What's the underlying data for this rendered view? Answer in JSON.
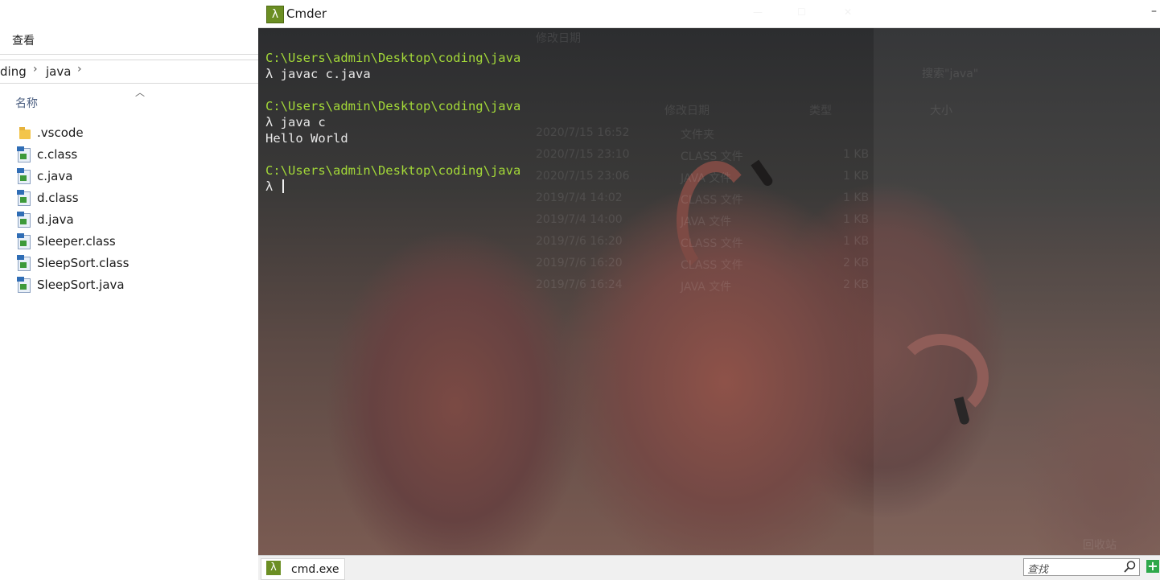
{
  "explorer": {
    "menu_tab": "查看",
    "breadcrumb": [
      "ding",
      "java"
    ],
    "column_header": "名称",
    "files": [
      {
        "name": ".vscode",
        "icon": "folder-icon"
      },
      {
        "name": "c.class",
        "icon": "java-file-icon"
      },
      {
        "name": "c.java",
        "icon": "java-file-icon"
      },
      {
        "name": "d.class",
        "icon": "java-file-icon"
      },
      {
        "name": "d.java",
        "icon": "java-file-icon"
      },
      {
        "name": "Sleeper.class",
        "icon": "java-file-icon"
      },
      {
        "name": "SleepSort.class",
        "icon": "java-file-icon"
      },
      {
        "name": "SleepSort.java",
        "icon": "java-file-icon"
      }
    ]
  },
  "cmder": {
    "title": "Cmder",
    "terminal": [
      {
        "path": "C:\\Users\\admin\\Desktop\\coding\\java",
        "command": "λ javac c.java",
        "output": ""
      },
      {
        "path": "C:\\Users\\admin\\Desktop\\coding\\java",
        "command": "λ java c",
        "output": "Hello World"
      },
      {
        "path": "C:\\Users\\admin\\Desktop\\coding\\java",
        "command": "λ ",
        "output": ""
      }
    ],
    "background_ghost": {
      "search_placeholder": "搜索\"java\"",
      "headers": [
        "修改日期",
        "类型",
        "大小"
      ],
      "rows": [
        {
          "date": "2020/7/15 16:52",
          "type": "文件夹",
          "size": ""
        },
        {
          "date": "2020/7/15 23:10",
          "type": "CLASS 文件",
          "size": "1 KB"
        },
        {
          "date": "2020/7/15 23:06",
          "type": "JAVA 文件",
          "size": "1 KB"
        },
        {
          "date": "2019/7/4 14:02",
          "type": "CLASS 文件",
          "size": "1 KB"
        },
        {
          "date": "2019/7/4 14:00",
          "type": "JAVA 文件",
          "size": "1 KB"
        },
        {
          "date": "2019/7/6 16:20",
          "type": "CLASS 文件",
          "size": "1 KB"
        },
        {
          "date": "2019/7/6 16:20",
          "type": "CLASS 文件",
          "size": "2 KB"
        },
        {
          "date": "2019/7/6 16:24",
          "type": "JAVA 文件",
          "size": "2 KB"
        }
      ],
      "recycle_label": "回收站"
    },
    "statusbar": {
      "tab_label": "cmd.exe",
      "search_placeholder": "查找"
    },
    "colors": {
      "prompt_path": "#a3d838",
      "command_text": "#e6e6e6",
      "cmder_icon": "#6b8e23",
      "add_button": "#2ea84a"
    }
  }
}
